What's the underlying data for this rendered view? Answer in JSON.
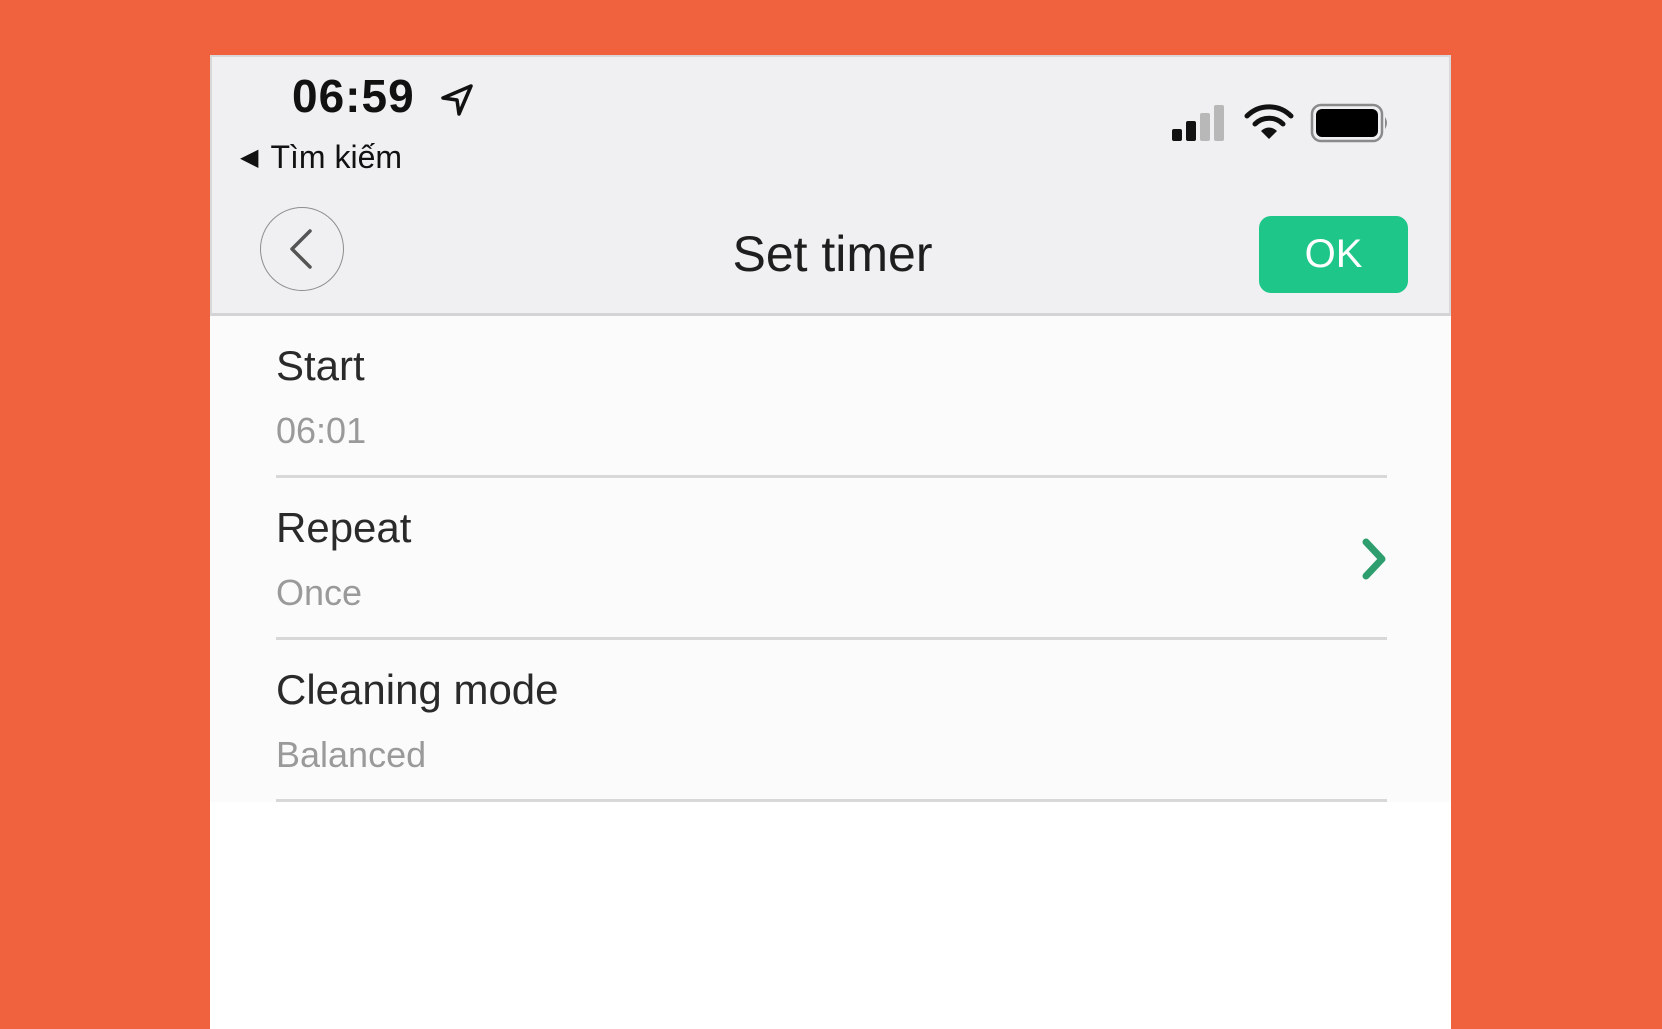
{
  "status_bar": {
    "time": "06:59",
    "back_app_label": "Tìm kiếm"
  },
  "nav": {
    "title": "Set timer",
    "ok_label": "OK"
  },
  "settings": [
    {
      "label": "Start",
      "value": "06:01",
      "has_chevron": false
    },
    {
      "label": "Repeat",
      "value": "Once",
      "has_chevron": true
    },
    {
      "label": "Cleaning mode",
      "value": "Balanced",
      "has_chevron": false
    }
  ],
  "colors": {
    "background": "#F0623D",
    "accent": "#1FC68A",
    "chevron": "#2E9E6E"
  }
}
